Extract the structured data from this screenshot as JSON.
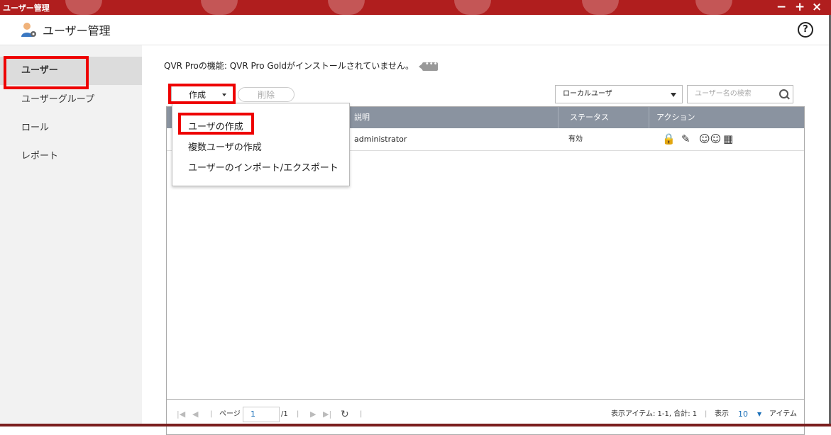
{
  "window": {
    "title": "ユーザー管理",
    "controls": {
      "minimize": "−",
      "maximize": "+",
      "close": "×"
    }
  },
  "header": {
    "title": "ユーザー管理",
    "help": "?"
  },
  "sidebar": {
    "items": [
      {
        "label": "ユーザー"
      },
      {
        "label": "ユーザーグループ"
      },
      {
        "label": "ロール"
      },
      {
        "label": "レポート"
      }
    ]
  },
  "main": {
    "notice": "QVR Proの機能: QVR Pro Goldがインストールされていません。",
    "notice_icon": "•••",
    "toolbar": {
      "create_label": "作成",
      "delete_label": "削除",
      "filter_value": "ローカルユーザ",
      "search_placeholder": "ユーザー名の検索"
    },
    "dropdown": {
      "items": [
        {
          "label": "ユーザの作成"
        },
        {
          "label": "複数ユーザの作成"
        },
        {
          "label": "ユーザーのインポート/エクスポート"
        }
      ]
    },
    "table": {
      "columns": [
        "説明",
        "ステータス",
        "アクション"
      ],
      "rows": [
        {
          "description": "administrator",
          "status": "有効"
        }
      ]
    },
    "footer": {
      "page_label": "ページ",
      "page_value": "1",
      "page_total": "/1",
      "display_items": "表示アイテム: 1-1, 合計: 1",
      "show_label": "表示",
      "per_page": "10",
      "items_label": "アイテム"
    }
  },
  "colors": {
    "titlebar": "#b01e1e",
    "highlight": "#ee0000",
    "table_header": "#8a93a0",
    "link": "#1a6fb8"
  }
}
